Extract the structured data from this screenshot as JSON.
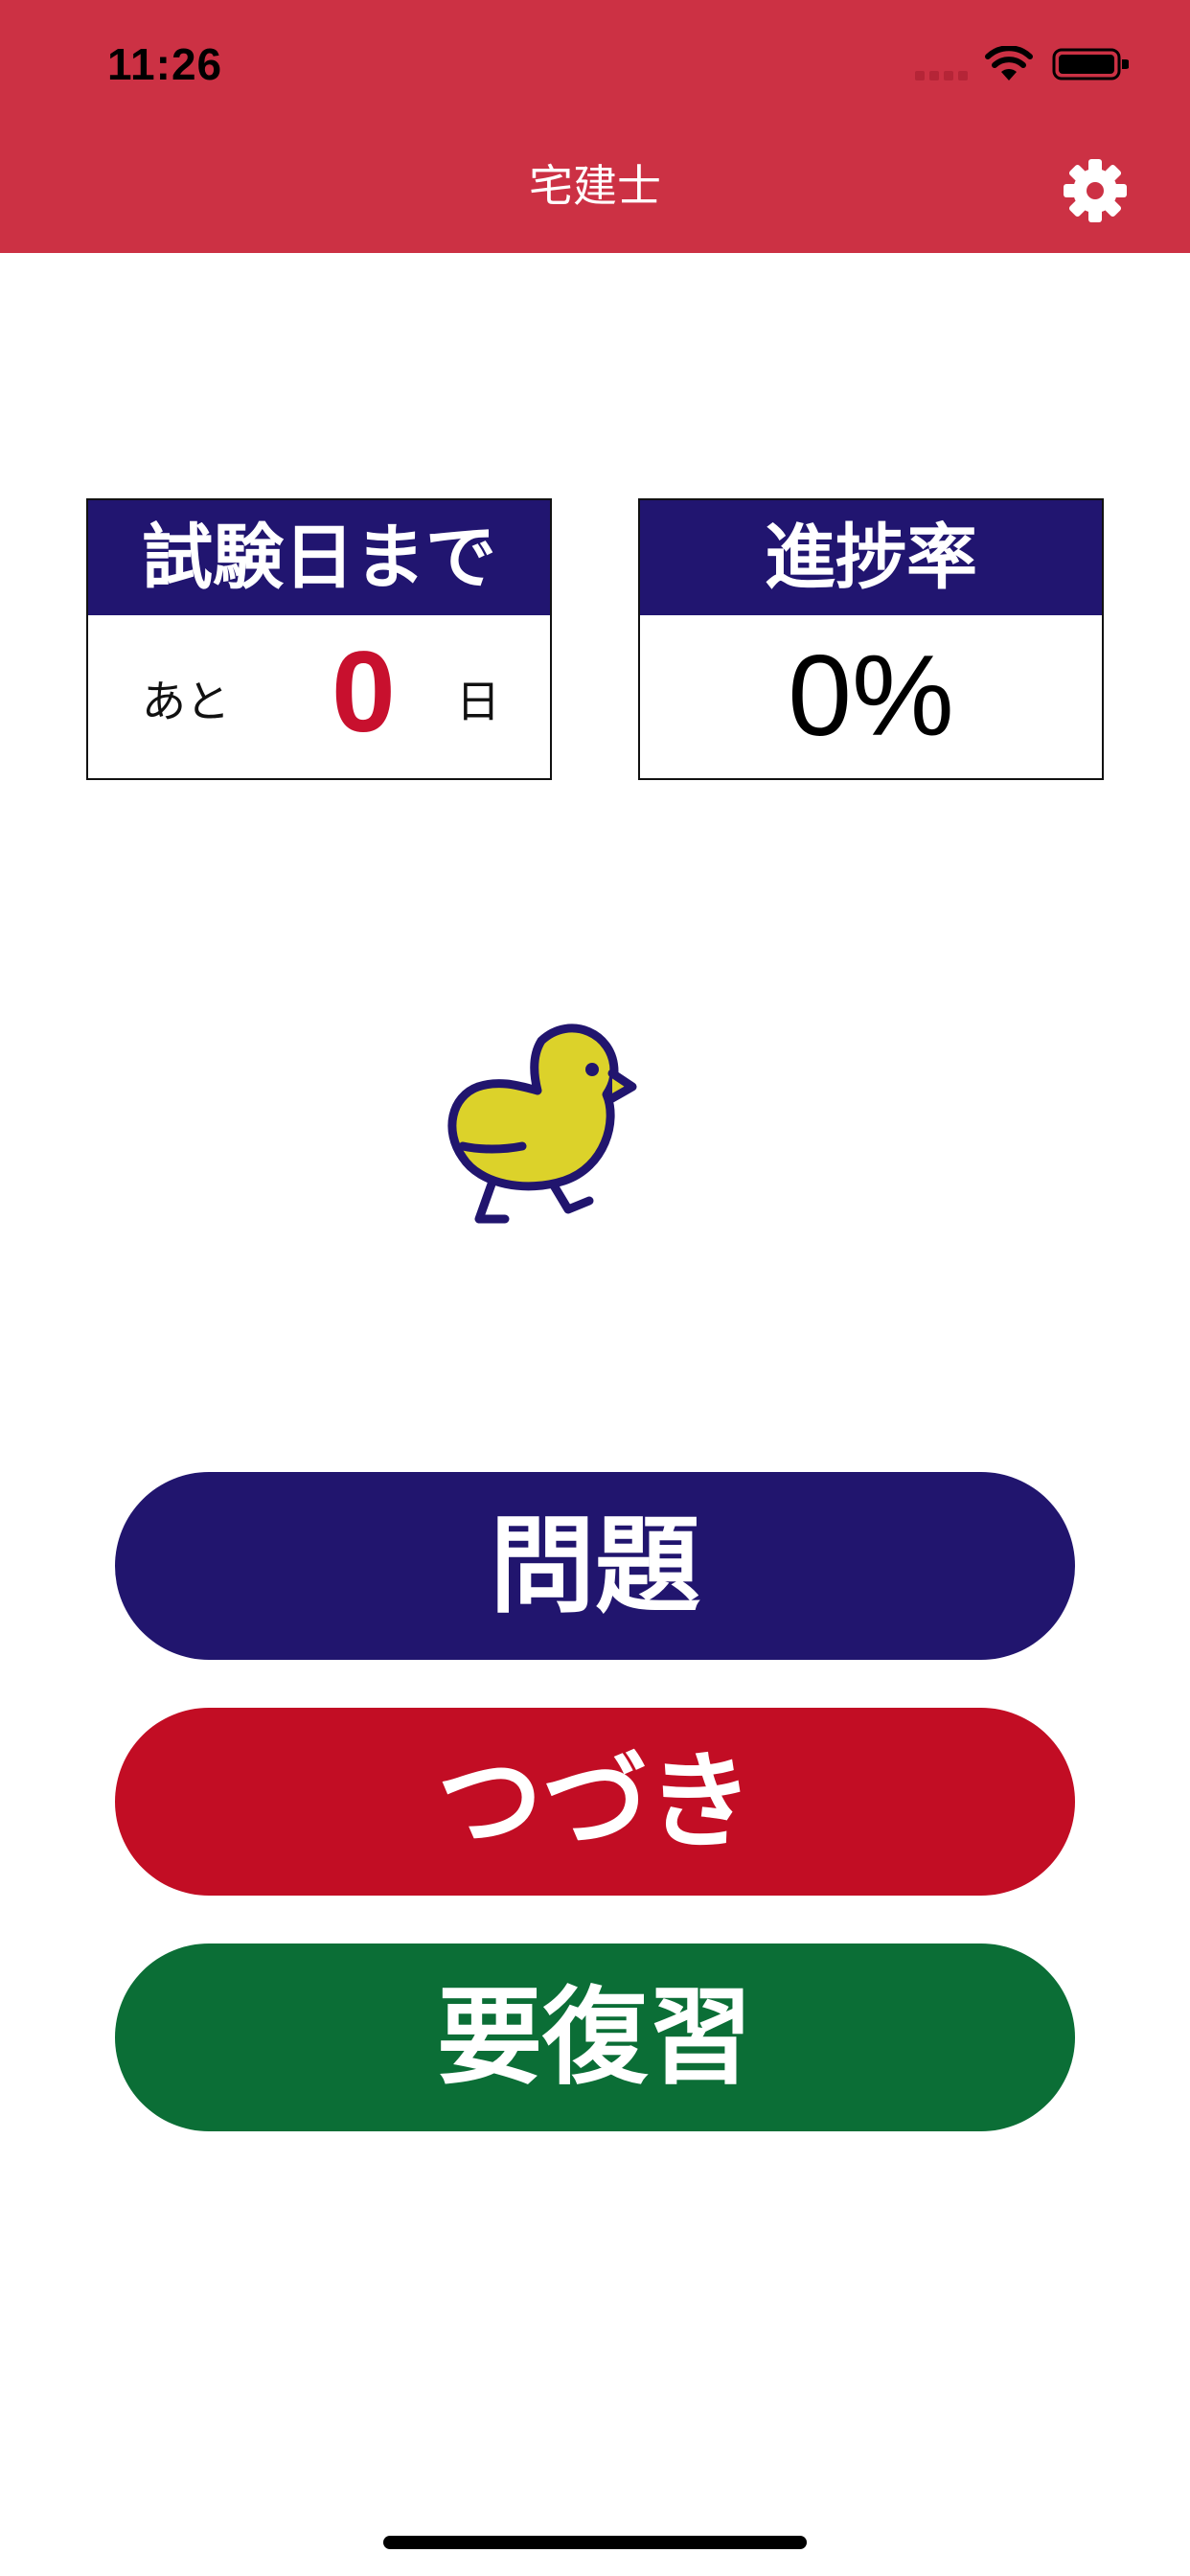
{
  "status_bar": {
    "time": "11:26"
  },
  "nav": {
    "title": "宅建士",
    "settings_icon": "gear-icon"
  },
  "exam_countdown": {
    "title": "試験日まで",
    "prefix": "あと",
    "days": "0",
    "suffix": "日"
  },
  "progress": {
    "title": "進捗率",
    "value": "0%"
  },
  "mascot": {
    "icon": "chick-icon"
  },
  "buttons": {
    "questions": "問題",
    "continue": "つづき",
    "review": "要復習"
  },
  "colors": {
    "header": "#cc3144",
    "navy": "#21156e",
    "red": "#c20d24",
    "green": "#0b6e36",
    "chick": "#dcd22a"
  }
}
